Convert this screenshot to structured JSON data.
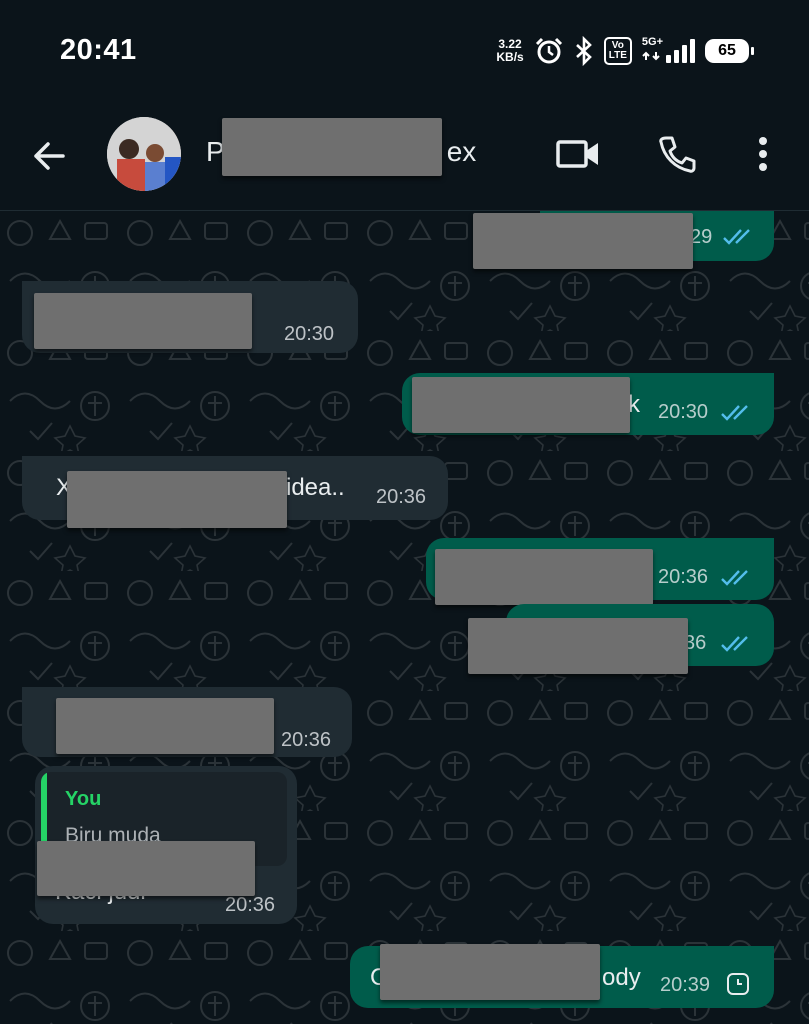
{
  "status_bar": {
    "time": "20:41",
    "net_speed_value": "3.22",
    "net_speed_unit": "KB/s",
    "volte_top": "Vo",
    "volte_bottom": "LTE",
    "network": "5G+",
    "battery": "65"
  },
  "header": {
    "contact_name_start": "P",
    "contact_name_end": "ex",
    "back_icon": "arrow-left-icon",
    "video_icon": "video-camera-icon",
    "call_icon": "phone-icon",
    "menu_icon": "more-vertical-icon"
  },
  "colors": {
    "background": "#0b141a",
    "incoming_bubble": "#202c33",
    "outgoing_bubble": "#005c4b",
    "read_ticks": "#53bdeb",
    "quote_accent": "#25d366"
  },
  "messages": [
    {
      "direction": "out",
      "text_visible": "",
      "time": "29",
      "status": "read"
    },
    {
      "direction": "in",
      "text_visible": "",
      "time": "20:30"
    },
    {
      "direction": "out",
      "text_visible": "k",
      "time": "20:30",
      "status": "read"
    },
    {
      "direction": "in",
      "text_start": "X",
      "text_end": "idea..",
      "time": "20:36"
    },
    {
      "direction": "out",
      "text_visible": "",
      "time": "20:36",
      "status": "read"
    },
    {
      "direction": "out",
      "text_visible": "36",
      "time": "36",
      "status": "read"
    },
    {
      "direction": "in",
      "text_visible": "",
      "time": "20:36"
    },
    {
      "direction": "in",
      "quote_author": "You",
      "quote_text": "Biru muda",
      "text_visible": "Kaci judi",
      "time": "20:36"
    },
    {
      "direction": "out",
      "text_start": "C",
      "text_end": "ody",
      "time": "20:39",
      "status": "pending"
    }
  ]
}
